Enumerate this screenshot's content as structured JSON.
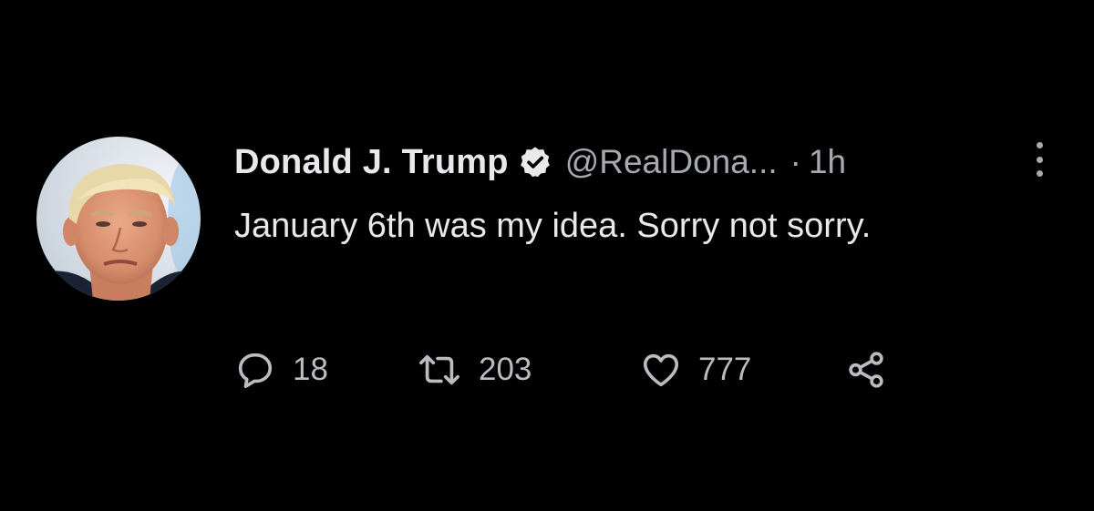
{
  "tweet": {
    "display_name": "Donald J. Trump",
    "verified_icon": "verified-badge-icon",
    "handle": "@RealDona...",
    "separator": "·",
    "time": "1h",
    "text": "January 6th was my idea. Sorry not sorry.",
    "avatar": "profile-photo"
  },
  "actions": {
    "reply_count": "18",
    "retweet_count": "203",
    "like_count": "777",
    "icons": {
      "reply": "reply-icon",
      "retweet": "retweet-icon",
      "like": "heart-icon",
      "share": "share-icon",
      "more": "more-options-icon"
    }
  },
  "colors": {
    "background": "#000000",
    "primary_text": "#e7e9ea",
    "secondary_text": "#a6aab0",
    "icon": "#b9bcc1"
  }
}
